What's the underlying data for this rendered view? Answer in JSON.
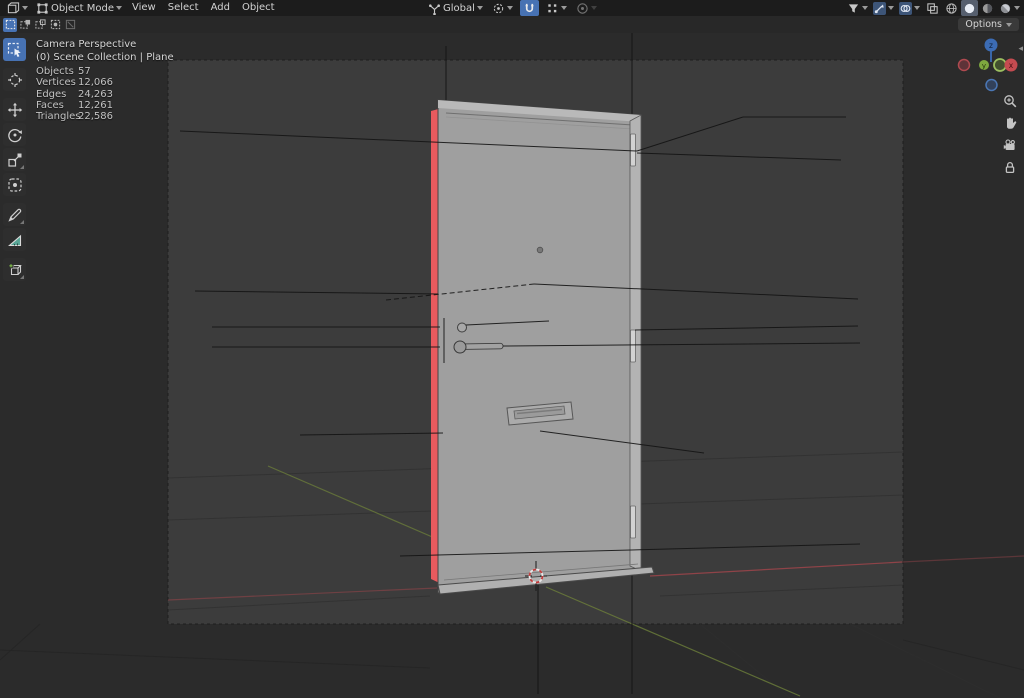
{
  "header": {
    "editor_icon": "3d-viewport-editor-icon",
    "mode": {
      "icon": "object-mode-icon",
      "label": "Object Mode"
    },
    "menus": [
      {
        "label": "View"
      },
      {
        "label": "Select"
      },
      {
        "label": "Add"
      },
      {
        "label": "Object"
      }
    ],
    "transform": {
      "orientation_icon": "transform-orientation-icon",
      "orientation_label": "Global",
      "pivot_icon": "pivot-point-icon",
      "snap_magnet_icon": "snap-magnet-icon",
      "snap_magnet_enabled": true,
      "snap_target_icon": "snap-target-icon",
      "proportional_icon": "proportional-editing-icon"
    },
    "right_icons": [
      "visibility-filter-icon",
      "gizmos-icon",
      "overlays-icon",
      "xray-icon",
      "shading-wireframe-icon",
      "shading-solid-icon",
      "shading-material-icon",
      "shading-rendered-icon"
    ],
    "shading_active": "solid"
  },
  "tool_settings": {
    "select_modes": [
      "set",
      "extend",
      "subtract",
      "invert",
      "intersect"
    ],
    "active_mode": "set",
    "options_label": "Options"
  },
  "toolbar": {
    "tools": [
      "select-box",
      "cursor",
      "move",
      "rotate",
      "scale",
      "transform",
      "annotate",
      "measure",
      "add-cube"
    ],
    "active_tool": "select-box"
  },
  "viewport": {
    "view_label": "Camera Perspective",
    "context_label": "(0) Scene Collection | Plane",
    "stats": {
      "rows": [
        {
          "label": "Objects",
          "value": "57"
        },
        {
          "label": "Vertices",
          "value": "12,066"
        },
        {
          "label": "Edges",
          "value": "24,263"
        },
        {
          "label": "Faces",
          "value": "12,261"
        },
        {
          "label": "Triangles",
          "value": "22,586"
        }
      ]
    },
    "nav_buttons": [
      "zoom-icon",
      "pan-hand-icon",
      "camera-view-icon",
      "lock-icon"
    ],
    "collapse_arrow": "◂"
  },
  "gizmo": {
    "axis_labels": {
      "x": "x",
      "y": "y",
      "z": "z"
    }
  },
  "colors": {
    "accent_blue": "#4772b3",
    "header_bg": "#1c1c1c",
    "viewport_outer": "#2b2b2b",
    "camera_bg": "#3c3c3c",
    "door_gray": "#9f9f9f",
    "door_red_edge": "#e85a5e",
    "axis_x_red": "#99444a",
    "axis_y_green": "#6d7f3a",
    "gizmo_x": "#c44b50",
    "gizmo_y": "#7ea83f",
    "gizmo_z": "#3c6cb4",
    "cursor_red": "#c23b3b"
  }
}
